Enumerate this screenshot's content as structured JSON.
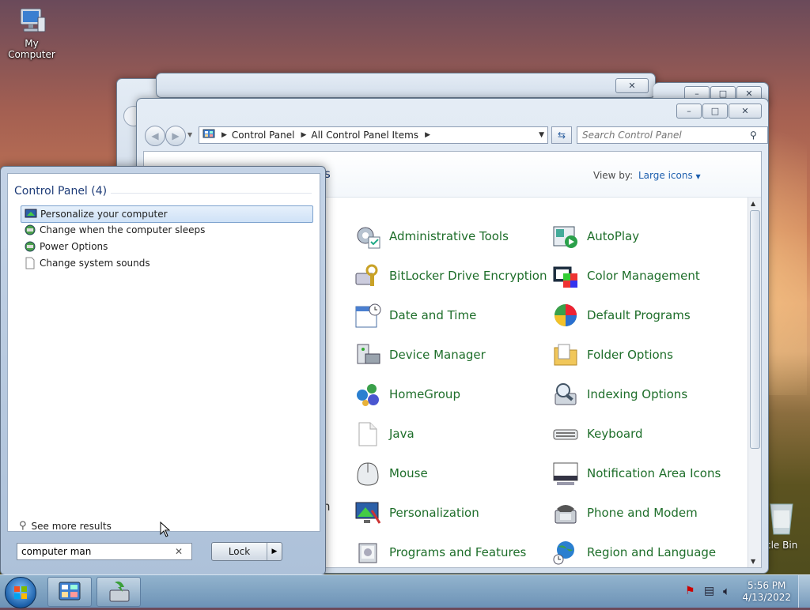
{
  "desktop": {
    "my_computer_label": "My Computer",
    "recycle_bin_label": "cle Bin"
  },
  "control_panel_window": {
    "address": {
      "crumbs": [
        "Control Panel",
        "All Control Panel Items"
      ]
    },
    "search_placeholder": "Search Control Panel",
    "view_by_label": "View by:",
    "view_by_value": "Large icons",
    "partial_heading_char": "s",
    "partial_left_char": "n",
    "items": [
      {
        "label": "Administrative Tools",
        "icon": "admin-tools-icon"
      },
      {
        "label": "AutoPlay",
        "icon": "autoplay-icon"
      },
      {
        "label": "BitLocker Drive Encryption",
        "icon": "bitlocker-icon"
      },
      {
        "label": "Color Management",
        "icon": "color-management-icon"
      },
      {
        "label": "Date and Time",
        "icon": "calendar-clock-icon"
      },
      {
        "label": "Default Programs",
        "icon": "default-programs-icon"
      },
      {
        "label": "Device Manager",
        "icon": "device-manager-icon"
      },
      {
        "label": "Folder Options",
        "icon": "folder-options-icon"
      },
      {
        "label": "HomeGroup",
        "icon": "homegroup-icon"
      },
      {
        "label": "Indexing Options",
        "icon": "indexing-options-icon"
      },
      {
        "label": "Java",
        "icon": "java-icon"
      },
      {
        "label": "Keyboard",
        "icon": "keyboard-icon"
      },
      {
        "label": "Mouse",
        "icon": "mouse-icon"
      },
      {
        "label": "Notification Area Icons",
        "icon": "notification-area-icon"
      },
      {
        "label": "Personalization",
        "icon": "personalization-icon"
      },
      {
        "label": "Phone and Modem",
        "icon": "phone-modem-icon"
      },
      {
        "label": "Programs and Features",
        "icon": "programs-features-icon"
      },
      {
        "label": "Region and Language",
        "icon": "region-language-icon"
      }
    ]
  },
  "start_menu": {
    "group_heading": "Control Panel (4)",
    "results": [
      {
        "label": "Personalize your computer",
        "icon": "personalize-icon",
        "selected": true
      },
      {
        "label": "Change when the computer sleeps",
        "icon": "power-icon",
        "selected": false
      },
      {
        "label": "Power Options",
        "icon": "power-icon",
        "selected": false
      },
      {
        "label": "Change system sounds",
        "icon": "document-icon",
        "selected": false
      }
    ],
    "see_more_label": "See more results",
    "search_value": "computer man",
    "lock_label": "Lock"
  },
  "taskbar": {
    "time": "5:56 PM",
    "date": "4/13/2022"
  },
  "colors": {
    "link_green": "#1e6e2a",
    "heading_blue": "#1e3c78"
  }
}
